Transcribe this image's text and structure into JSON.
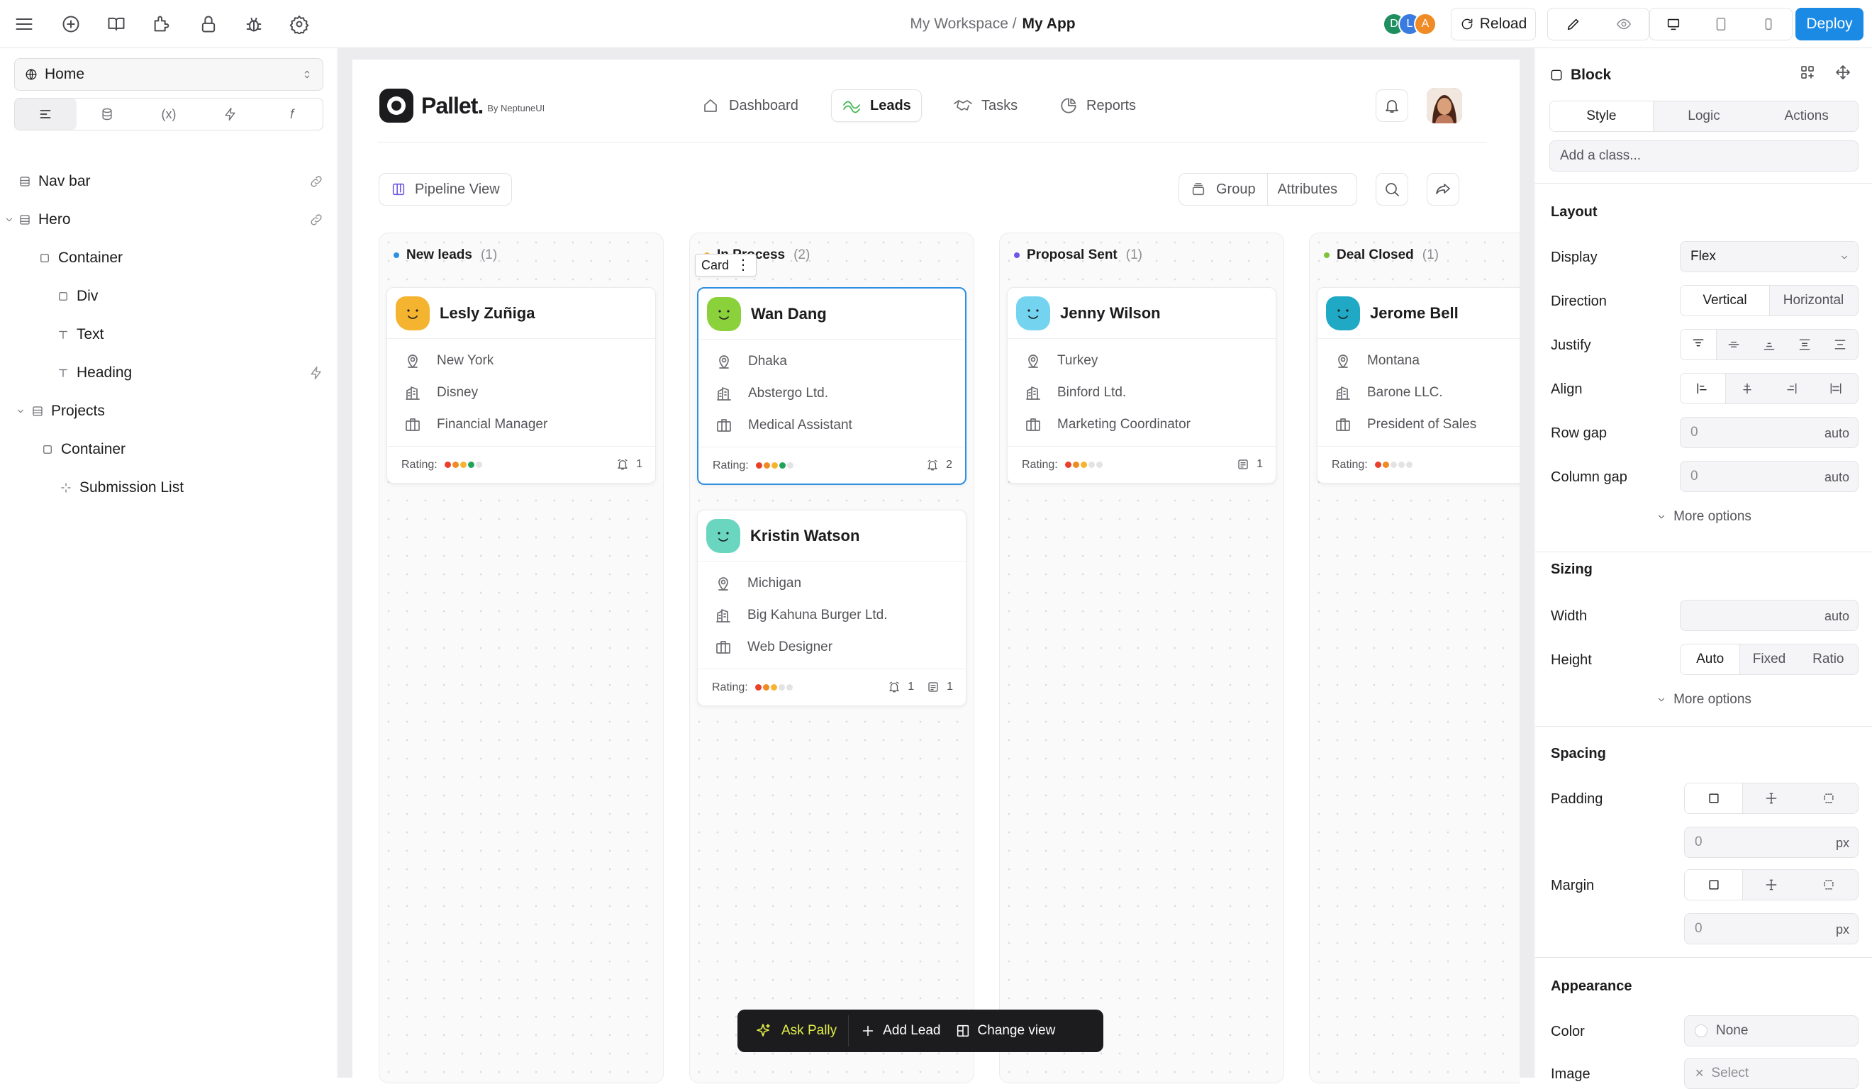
{
  "breadcrumb": {
    "workspace": "My Workspace /",
    "app": "My App"
  },
  "collaborators": [
    {
      "initial": "D",
      "color": "#1f8f5f"
    },
    {
      "initial": "L",
      "color": "#3a7be0"
    },
    {
      "initial": "A",
      "color": "#f08a24"
    }
  ],
  "toolbar": {
    "reload_label": "Reload",
    "deploy_label": "Deploy"
  },
  "left_panel": {
    "page_select": "Home",
    "tabs": [
      "layers",
      "data",
      "(x)",
      "actions",
      "f"
    ],
    "tree": [
      {
        "label": "Nav bar",
        "icon": "section-icon"
      },
      {
        "label": "Hero",
        "icon": "section-icon"
      },
      {
        "label": "Container",
        "icon": "box-icon"
      },
      {
        "label": "Div",
        "icon": "box-icon"
      },
      {
        "label": "Text",
        "icon": "text-icon"
      },
      {
        "label": "Heading",
        "icon": "text-icon"
      },
      {
        "label": "Projects",
        "icon": "section-icon"
      },
      {
        "label": "Container",
        "icon": "box-icon"
      },
      {
        "label": "Submission List",
        "icon": "list-icon"
      }
    ]
  },
  "app": {
    "logo_text": "Pallet.",
    "logo_by": "By NeptuneUI",
    "nav": [
      {
        "label": "Dashboard",
        "icon": "home-icon"
      },
      {
        "label": "Leads",
        "icon": "leads-icon"
      },
      {
        "label": "Tasks",
        "icon": "handshake-icon"
      },
      {
        "label": "Reports",
        "icon": "reports-icon"
      }
    ],
    "pipeline_view_label": "Pipeline View",
    "group_label": "Group",
    "attributes_label": "Attributes",
    "card_tag_label": "Card",
    "rating_label": "Rating:",
    "columns": [
      {
        "title": "New leads",
        "count": "(1)",
        "dot_color": "#2f8fe3",
        "cards": [
          {
            "name": "Lesly Zuñiga",
            "location": "New York",
            "company": "Disney",
            "role": "Financial Manager",
            "rating": 4,
            "alerts": "1",
            "notes": "",
            "avatar_color": "#f5b430"
          }
        ]
      },
      {
        "title": "In Process",
        "count": "(2)",
        "dot_color": "#f5b430",
        "cards": [
          {
            "name": "Wan Dang",
            "location": "Dhaka",
            "company": "Abstergo Ltd.",
            "role": "Medical Assistant",
            "rating": 4,
            "alerts": "2",
            "notes": "",
            "avatar_color": "#8bd13c",
            "selected": true
          },
          {
            "name": "Kristin Watson",
            "location": "Michigan",
            "company": "Big Kahuna Burger Ltd.",
            "role": "Web Designer",
            "rating": 3,
            "alerts": "1",
            "notes": "1",
            "avatar_color": "#6ad6c0"
          }
        ]
      },
      {
        "title": "Proposal Sent",
        "count": "(1)",
        "dot_color": "#6b57e3",
        "cards": [
          {
            "name": "Jenny Wilson",
            "location": "Turkey",
            "company": "Binford Ltd.",
            "role": "Marketing Coordinator",
            "rating": 3,
            "alerts": "",
            "notes": "1",
            "avatar_color": "#74d4ef"
          }
        ]
      },
      {
        "title": "Deal Closed",
        "count": "(1)",
        "dot_color": "#7cc43a",
        "cards": [
          {
            "name": "Jerome Bell",
            "location": "Montana",
            "company": "Barone LLC.",
            "role": "President of Sales",
            "rating": 2,
            "alerts": "",
            "notes": "",
            "avatar_color": "#1fa9c4"
          }
        ]
      }
    ],
    "rating_colors": [
      "#e8402a",
      "#f08a24",
      "#f5b430",
      "#22a35a"
    ],
    "bottom_bar": {
      "ask": "Ask Pally",
      "add": "Add Lead",
      "change": "Change view"
    }
  },
  "right_panel": {
    "block_label": "Block",
    "tabs": [
      "Style",
      "Logic",
      "Actions"
    ],
    "class_placeholder": "Add a class...",
    "layout": {
      "title": "Layout",
      "display_label": "Display",
      "display_value": "Flex",
      "direction_label": "Direction",
      "direction_options": [
        "Vertical",
        "Horizontal"
      ],
      "justify_label": "Justify",
      "align_label": "Align",
      "row_gap_label": "Row gap",
      "row_gap_value": "0",
      "row_gap_unit": "auto",
      "column_gap_label": "Column gap",
      "column_gap_value": "0",
      "column_gap_unit": "auto",
      "more_label": "More options"
    },
    "sizing": {
      "title": "Sizing",
      "width_label": "Width",
      "width_unit": "auto",
      "height_label": "Height",
      "height_options": [
        "Auto",
        "Fixed",
        "Ratio"
      ],
      "more_label": "More options"
    },
    "spacing": {
      "title": "Spacing",
      "padding_label": "Padding",
      "padding_value": "0",
      "padding_unit": "px",
      "margin_label": "Margin",
      "margin_value": "0",
      "margin_unit": "px"
    },
    "appearance": {
      "title": "Appearance",
      "color_label": "Color",
      "color_value": "None",
      "image_label": "Image",
      "image_value": "Select"
    }
  }
}
